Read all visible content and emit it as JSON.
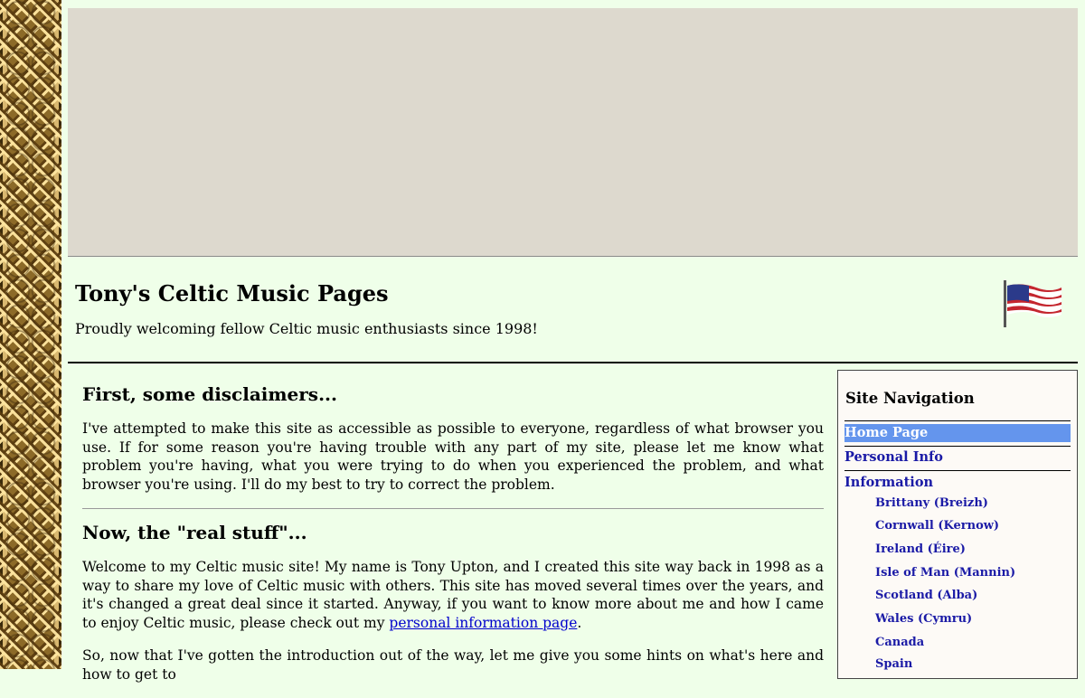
{
  "header": {
    "title": "Tony's Celtic Music Pages",
    "tagline": "Proudly welcoming fellow Celtic music enthusiasts since 1998!",
    "flag_icon": "us-flag-icon"
  },
  "main": {
    "section1": {
      "heading": "First, some disclaimers...",
      "paragraph": "I've attempted to make this site as accessible as possible to everyone, regardless of what browser you use. If for some reason you're having trouble with any part of my site, please let me know what problem you're having, what you were trying to do when you experienced the problem, and what browser you're using. I'll do my best to try to correct the problem."
    },
    "section2": {
      "heading": "Now, the \"real stuff\"...",
      "paragraph_before_link": "Welcome to my Celtic music site! My name is Tony Upton, and I created this site way back in 1998 as a way to share my love of Celtic music with others. This site has moved several times over the years, and it's changed a great deal since it started. Anyway, if you want to know more about me and how I came to enjoy Celtic music, please check out my ",
      "link_text": "personal information page",
      "paragraph_after_link": ".",
      "paragraph2": "So, now that I've gotten the introduction out of the way, let me give you some hints on what's here and how to get to"
    }
  },
  "nav": {
    "title": "Site Navigation",
    "home": "Home Page",
    "personal": "Personal Info",
    "information": "Information",
    "subitems": [
      "Brittany (Breizh)",
      "Cornwall (Kernow)",
      "Ireland (Éire)",
      "Isle of Man (Mannin)",
      "Scotland (Alba)",
      "Wales (Cymru)",
      "Canada",
      "Spain"
    ]
  },
  "colors": {
    "page_bg": "#efffe9",
    "banner_bg": "#ddd9ce",
    "nav_active_bg": "#6495ed",
    "link": "#1a1aa6"
  }
}
